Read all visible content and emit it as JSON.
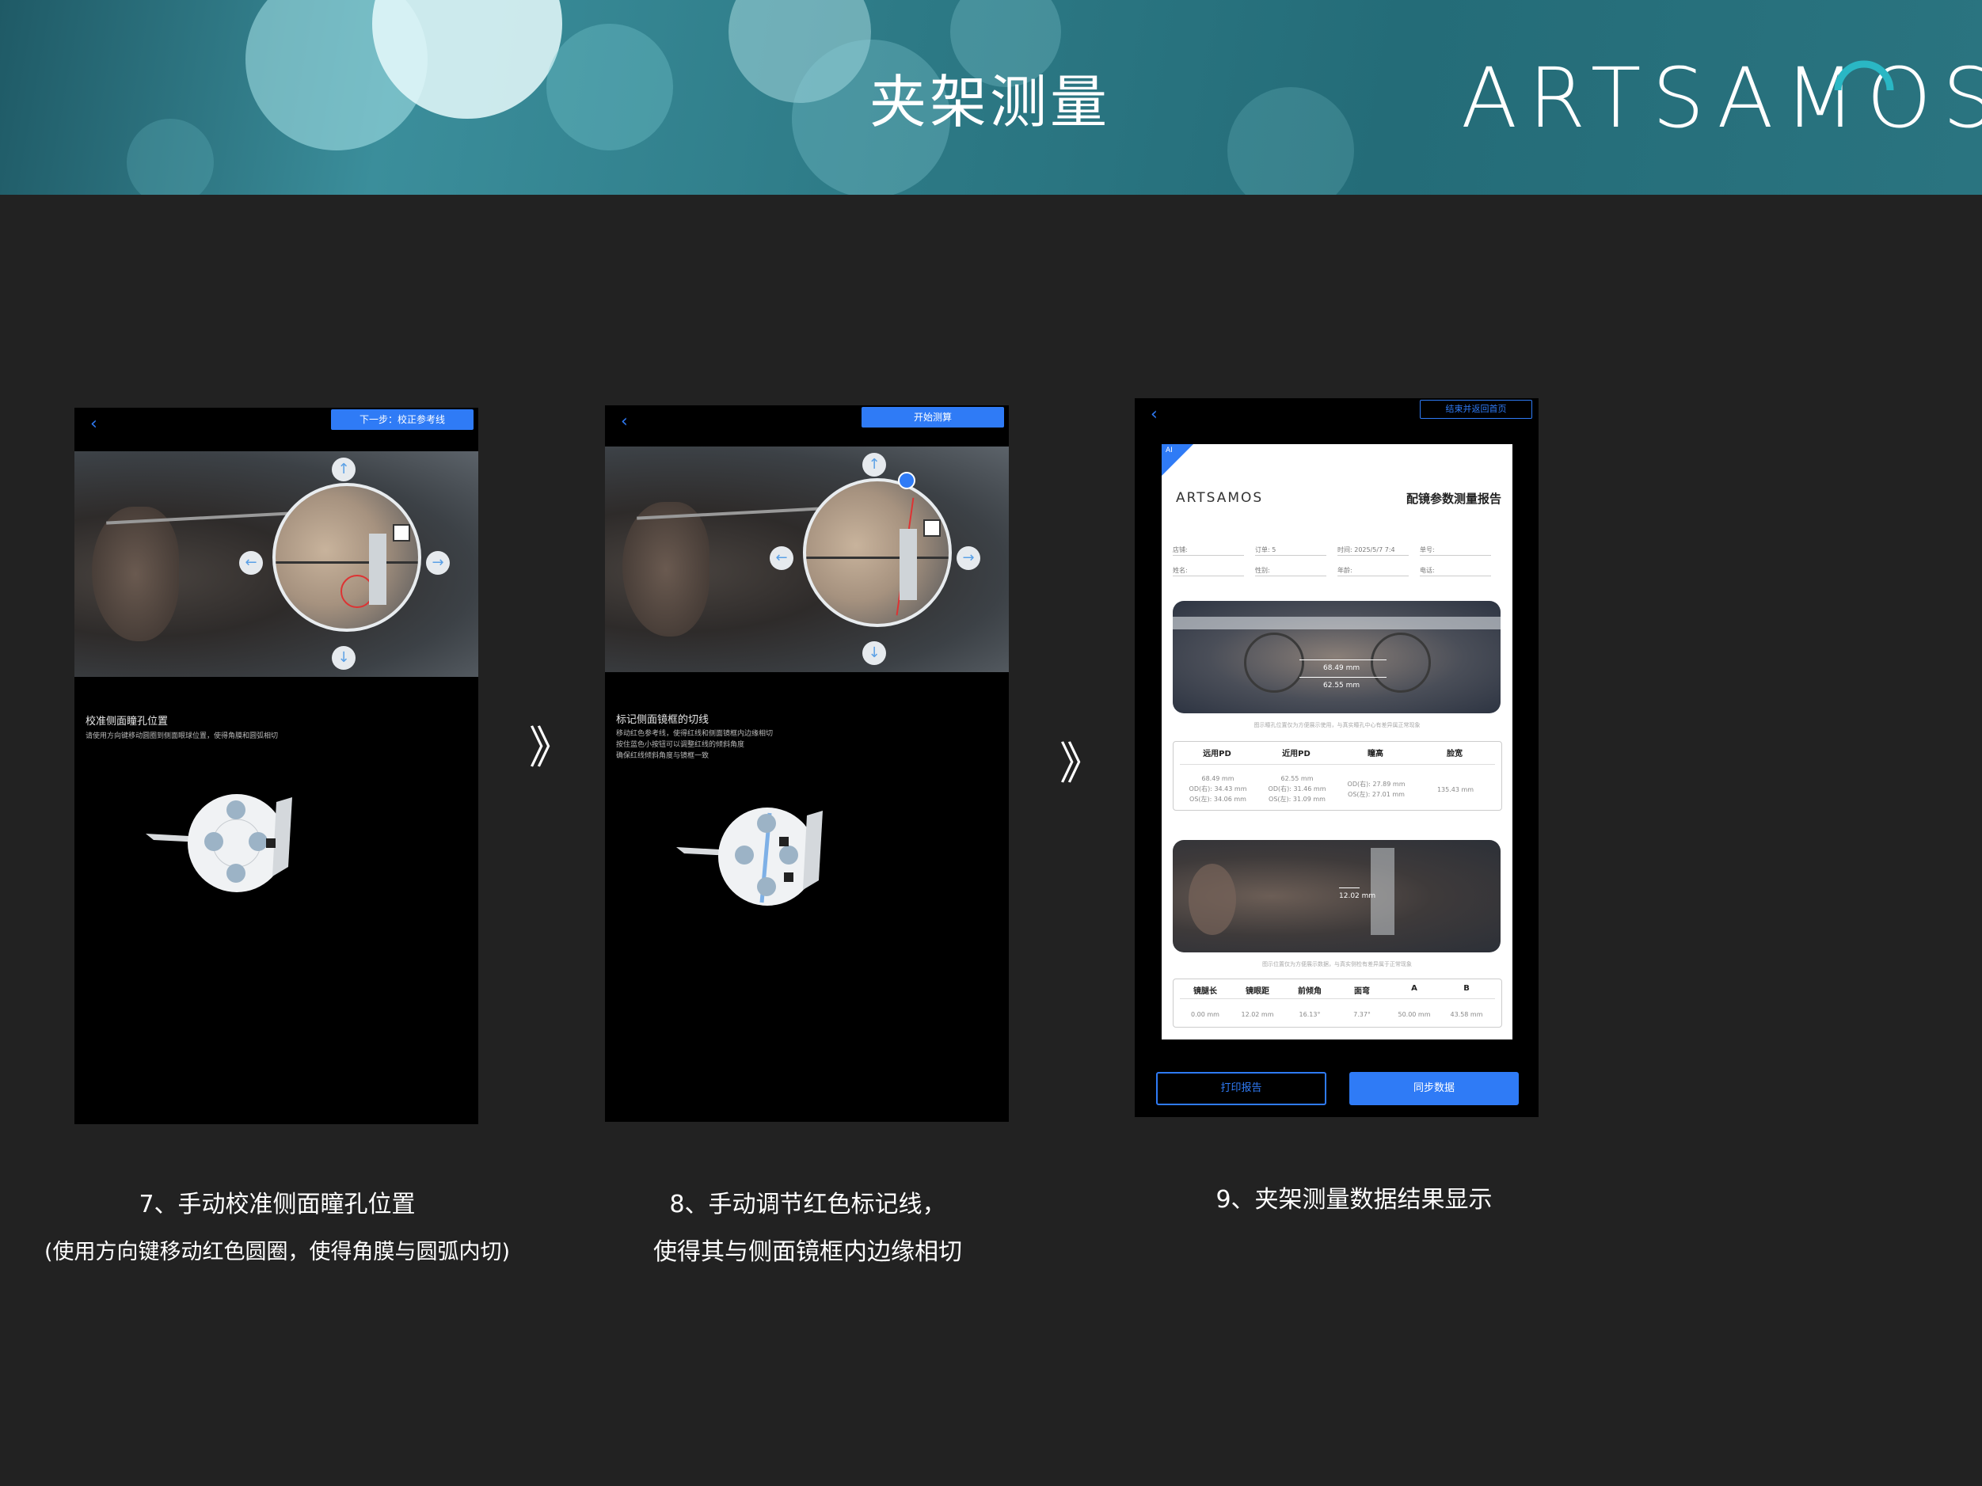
{
  "banner": {
    "title": "夹架测量",
    "logo_text": "ARTSAMOS",
    "logo_accent": "#2ab7c4"
  },
  "colors": {
    "background": "#222222",
    "accent_blue": "#2f7bf6"
  },
  "step7": {
    "back_icon": "chevron-left-icon",
    "next_button": "下一步：校正参考线",
    "title": "校准侧面瞳孔位置",
    "desc": "请使用方向键移动圆圈到侧面眼球位置，使得角膜和圆弧相切",
    "caption_line1": "7、手动校准侧面瞳孔位置",
    "caption_line2": "(使用方向键移动红色圆圈，使得角膜与圆弧内切)"
  },
  "step8": {
    "start_button": "开始测算",
    "title": "标记侧面镜框的切线",
    "desc_line1": "移动红色参考线，使得红线和侧面镜框内边缘相切",
    "desc_line2": "按住蓝色小按钮可以调整红线的倾斜角度",
    "desc_line3": "确保红线倾斜角度与镜框一致",
    "caption_line1": "8、手动调节红色标记线，",
    "caption_line2": "使得其与侧面镜框内边缘相切"
  },
  "step9": {
    "end_button": "结束并返回首页",
    "ai_badge": "AI",
    "report_logo": "ARTSAMOS",
    "report_title": "配镜参数测量报告",
    "form_row1": [
      "店铺:",
      "订单:",
      "时间:",
      "单号:"
    ],
    "order_value": "5",
    "time_value": "2025/5/7 7:4",
    "form_row2": [
      "姓名:",
      "性别:",
      "年龄:",
      "电话:"
    ],
    "front_far_pd": "68.49 mm",
    "front_near_pd": "62.55 mm",
    "front_note": "图示瞳孔位置仅为方便展示使用，与真实瞳孔中心有差异属正常现象",
    "table1_headers": [
      "远用PD",
      "近用PD",
      "瞳高",
      "脸宽"
    ],
    "table1_far": [
      "68.49 mm",
      "OD(右): 34.43 mm",
      "OS(左): 34.06 mm"
    ],
    "table1_near": [
      "62.55 mm",
      "OD(右): 31.46 mm",
      "OS(左): 31.09 mm"
    ],
    "table1_height": [
      "OD(右): 27.89 mm",
      "OS(左): 27.01 mm"
    ],
    "table1_face": "135.43 mm",
    "side_distance": "12.02 mm",
    "side_note": "图示位置仅为方便展示数据，与真实侧检有差异属于正常现象",
    "table2_headers": [
      "镜腿长",
      "镜眼距",
      "前倾角",
      "面弯",
      "A",
      "B"
    ],
    "table2_values": [
      "0.00 mm",
      "12.02 mm",
      "16.13°",
      "7.37°",
      "50.00 mm",
      "43.58 mm"
    ],
    "print_button": "打印报告",
    "sync_button": "同步数据",
    "caption": "9、夹架测量数据结果显示"
  },
  "separator_icon": "double-chevron-right-icon",
  "separator_glyph": "》"
}
